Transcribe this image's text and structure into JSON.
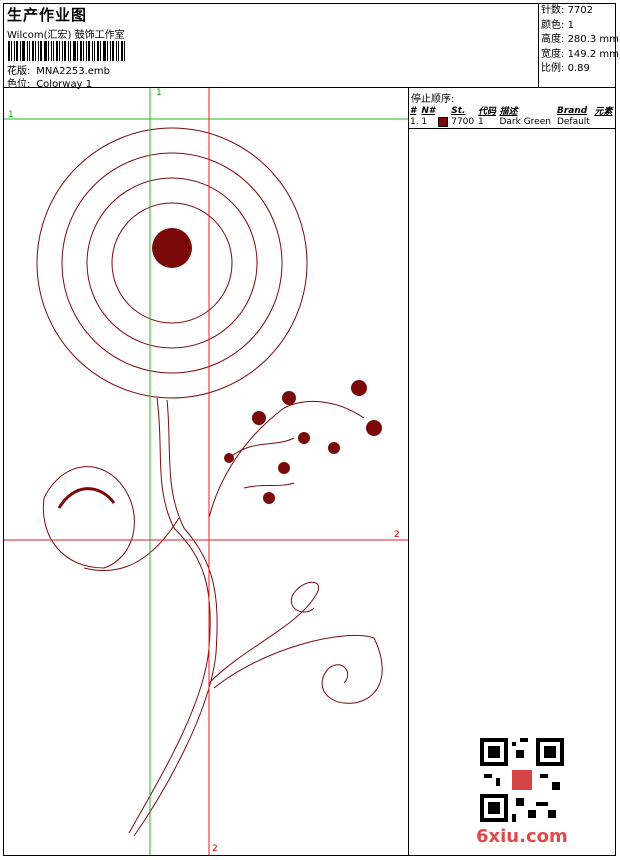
{
  "header": {
    "title": "生产作业图",
    "company": "Wilcom(汇宏) 鼓饰工作室",
    "design_label": "花版:",
    "design_value": "MNA2253.emb",
    "color_label": "色位:",
    "color_value": "Colorway 1"
  },
  "stats": [
    {
      "label": "针数",
      "value": "7702"
    },
    {
      "label": "颜色",
      "value": "1"
    },
    {
      "label": "高度",
      "value": "280.3 mm"
    },
    {
      "label": "宽度",
      "value": "149.2 mm"
    },
    {
      "label": "比例",
      "value": "0.89"
    }
  ],
  "stop_sequence": {
    "heading": "停止顺序:",
    "columns": [
      "#",
      "N#",
      "St.",
      "代码",
      "描述",
      "Brand",
      "元素"
    ],
    "rows": [
      {
        "idx": "1.",
        "n": "1",
        "color": "#7a0a0a",
        "st": "7700",
        "code": "1",
        "desc": "Dark Green",
        "brand": "Default",
        "elem": ""
      }
    ]
  },
  "guides": {
    "top_green": "1",
    "left_green": "1",
    "right_red": "2",
    "bottom_red": "2"
  },
  "watermark": "6xiu.com",
  "colors": {
    "thread": "#7a0a0a",
    "guide_green": "#22bb22",
    "guide_red": "#dd2222"
  }
}
